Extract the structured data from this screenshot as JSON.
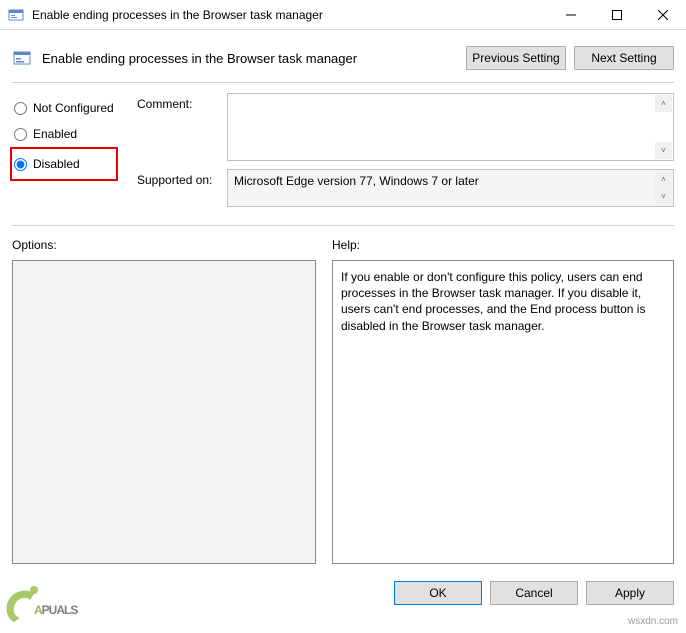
{
  "window": {
    "title": "Enable ending processes in the Browser task manager"
  },
  "header": {
    "policy_title": "Enable ending processes in the Browser task manager",
    "prev_btn": "Previous Setting",
    "next_btn": "Next Setting"
  },
  "state": {
    "not_configured": "Not Configured",
    "enabled": "Enabled",
    "disabled": "Disabled"
  },
  "fields": {
    "comment_label": "Comment:",
    "comment_value": "",
    "supported_label": "Supported on:",
    "supported_value": "Microsoft Edge version 77, Windows 7 or later"
  },
  "lower": {
    "options_label": "Options:",
    "help_label": "Help:",
    "help_text": "If you enable or don't configure this policy, users can end processes in the Browser task manager. If you disable it, users can't end processes, and the End process button is disabled in the Browser task manager."
  },
  "buttons": {
    "ok": "OK",
    "cancel": "Cancel",
    "apply": "Apply"
  },
  "watermark": "wsxdn.com",
  "brand": "PPUALS"
}
